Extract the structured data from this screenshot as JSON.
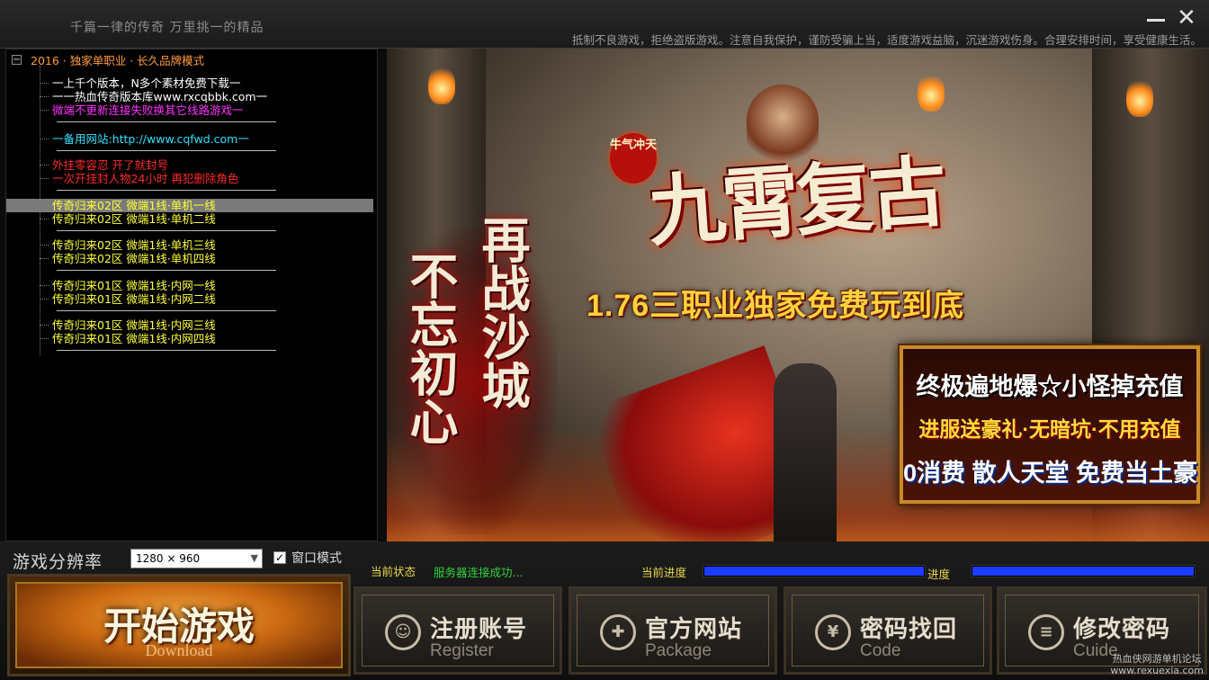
{
  "titlebar": {
    "slogan": "千篇一律的传奇  万里挑一的精品",
    "notice": "抵制不良游戏，拒绝盗版游戏。注意自我保护，谨防受骗上当，适度游戏益脑，沉迷游戏伤身。合理安排时间，享受健康生活。",
    "minimize_icon": "minimize-icon",
    "close_icon": "close-icon",
    "close_glyph": "✕"
  },
  "tree": {
    "expander": "−",
    "root_label": "2016 · 独家单职业 · 长久品牌模式",
    "nodes": [
      {
        "text": "一上千个版本，N多个素材免费下载一",
        "color": "#ffffff"
      },
      {
        "text": "一一热血传奇版本库www.rxcqbbk.com一",
        "color": "#ffffff"
      },
      {
        "text": "微端不更新连接失败换其它线路游戏一",
        "color": "#ff33ff"
      },
      {
        "text": "一备用网站:http://www.cqfwd.com一",
        "color": "#33e0ff"
      },
      {
        "text": "                外挂零容忍 开了就封号",
        "color": "#ff2a2a"
      },
      {
        "text": "一次开挂封人物24小时 再犯删除角色",
        "color": "#ff2a2a"
      },
      {
        "text": "传奇归来02区    微端1线·单机一线",
        "color": "#ffff33"
      },
      {
        "text": "传奇归来02区    微端1线·单机二线",
        "color": "#ffff33"
      },
      {
        "text": "传奇归来02区    微端1线·单机三线",
        "color": "#ffff33"
      },
      {
        "text": "传奇归来02区    微端1线·单机四线",
        "color": "#ffff33"
      },
      {
        "text": "传奇归来01区    微端1线·内网一线",
        "color": "#ffff33"
      },
      {
        "text": "传奇归来01区    微端1线·内网二线",
        "color": "#ffff33"
      },
      {
        "text": "传奇归来01区    微端1线·内网三线",
        "color": "#ffff33"
      },
      {
        "text": "传奇归来01区    微端1线·内网四线",
        "color": "#ffff33"
      }
    ]
  },
  "banner": {
    "logo": "九霄复古",
    "seal": "牛气冲天",
    "subtitle": "1.76三职业独家免费玩到底",
    "vertical_1": "再战沙城",
    "vertical_2": "不忘初心",
    "promo_1": "终极遍地爆☆小怪掉充值",
    "promo_2": "进服送豪礼·无暗坑·不用充值",
    "promo_3": "0消费 散人天堂 免费当土豪"
  },
  "bottom": {
    "resolution_label": "游戏分辨率",
    "resolution_value": "1280 × 960",
    "caret": "▼",
    "window_mode_label": "窗口模式",
    "window_mode_checked": true,
    "check_glyph": "✓",
    "status_label": "当前状态",
    "status_text": "服务器连接成功...",
    "progress_label": "当前进度",
    "progress_value": 1.0,
    "progress2_label": "进度",
    "progress2_value": 1.0
  },
  "buttons": {
    "start_title": "开始游戏",
    "start_sub": "Download",
    "register_title": "注册账号",
    "register_sub": "Register",
    "register_glyph": "☺",
    "package_title": "官方网站",
    "package_sub": "Package",
    "package_glyph": "✚",
    "code_title": "密码找回",
    "code_sub": "Code",
    "code_glyph": "¥",
    "guide_title": "修改密码",
    "guide_sub": "Cuide",
    "guide_glyph": "≡"
  },
  "watermark": {
    "line1": "热血侠网游单机论坛",
    "line2": "www.rexuexia.com"
  }
}
